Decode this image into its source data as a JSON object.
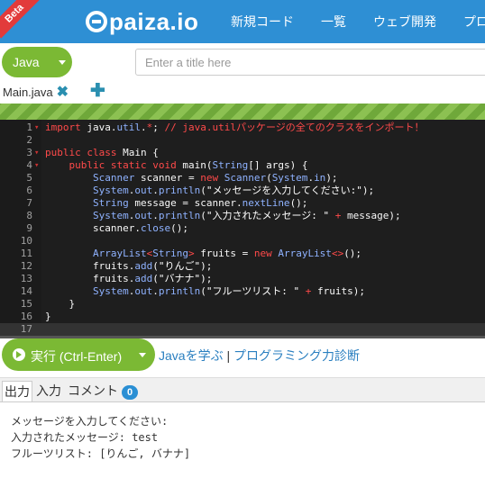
{
  "header": {
    "badge": "Beta",
    "logo": "paiza.io",
    "nav": [
      "新規コード",
      "一覧",
      "ウェブ開発",
      "プロ"
    ]
  },
  "toolbar": {
    "language": "Java",
    "title_placeholder": "Enter a title here"
  },
  "tabs": {
    "file": "Main.java",
    "close": "✖",
    "add": "✚"
  },
  "editor": {
    "line_numbers": [
      "1",
      "2",
      "3",
      "4",
      "5",
      "6",
      "7",
      "8",
      "9",
      "10",
      "11",
      "12",
      "13",
      "14",
      "15",
      "16",
      "17"
    ],
    "lines": [
      "import java.util.*; // java.utilパッケージの全てのクラスをインポート！",
      "",
      "public class Main {",
      "    public static void main(String[] args) {",
      "        Scanner scanner = new Scanner(System.in);",
      "        System.out.println(\"メッセージを入力してください:\");",
      "        String message = scanner.nextLine();",
      "        System.out.println(\"入力されたメッセージ: \" + message);",
      "        scanner.close();",
      "",
      "        ArrayList<String> fruits = new ArrayList<>();",
      "        fruits.add(\"りんご\");",
      "        fruits.add(\"バナナ\");",
      "        System.out.println(\"フルーツリスト: \" + fruits);",
      "    }",
      "}",
      ""
    ]
  },
  "run": {
    "label": "実行 (Ctrl-Enter)",
    "learn_link": "Javaを学ぶ",
    "separator": "|",
    "diag_link": "プログラミング力診断"
  },
  "output_tabs": {
    "output": "出力",
    "input": "入力",
    "comment": "コメント",
    "comment_count": "0"
  },
  "output": {
    "lines": [
      "メッセージを入力してください:",
      "入力されたメッセージ: test",
      "フルーツリスト: [りんご, バナナ]"
    ]
  },
  "colors": {
    "header": "#2e8fd4",
    "green": "#7bb934",
    "editor_bg": "#1e1e1e",
    "link": "#2a7fc0"
  }
}
